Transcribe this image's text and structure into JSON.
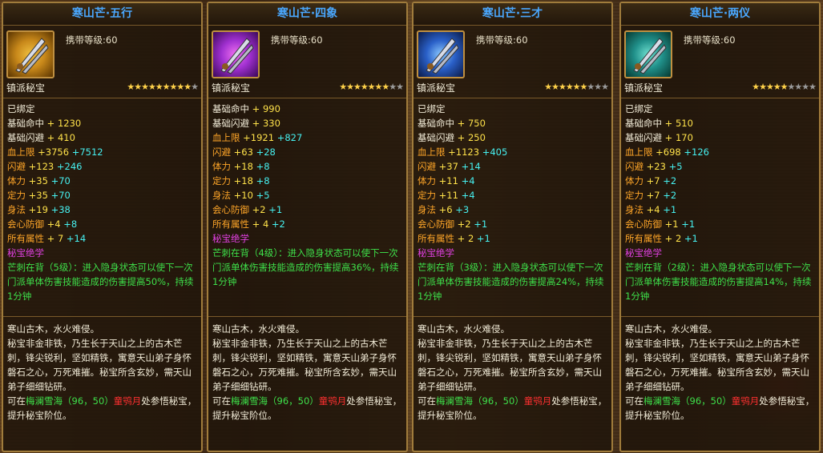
{
  "cards": [
    {
      "title": "寒山芒·五行",
      "level": "携带等级:60",
      "sect": "镇派秘宝",
      "stars_on": 9,
      "stars_off": 1,
      "bound": "已绑定",
      "hit": {
        "label": "基础命中",
        "value": "+ 1230"
      },
      "dodge": {
        "label": "基础闪避",
        "value": "+ 410"
      },
      "hp": {
        "label": "血上限",
        "value": "+3756",
        "bonus": "+7512"
      },
      "evade": {
        "label": "闪避",
        "value": "+123",
        "bonus": "+246"
      },
      "con": {
        "label": "体力",
        "value": "+35",
        "bonus": "+70"
      },
      "wis": {
        "label": "定力",
        "value": "+35",
        "bonus": "+70"
      },
      "agi": {
        "label": "身法",
        "value": "+19",
        "bonus": "+38"
      },
      "critdef": {
        "label": "会心防御",
        "value": "+4",
        "bonus": "+8"
      },
      "allattr": {
        "label": "所有属性",
        "value": "+ 7",
        "bonus": "+14"
      },
      "skill_title": "秘宝绝学",
      "skill_desc": "芒刺在背（5级）：进入隐身状态可以使下一次门派单体伤害技能造成的伤害提高50%，持续1分钟",
      "desc1": "寒山古木，水火难侵。",
      "desc2": "秘宝非金非铁，乃生长于天山之上的古木芒刺，锋尖锐利，坚如精铁，寓意天山弟子身怀磐石之心，万死难摧。秘宝所含玄妙，需天山弟子细细钻研。",
      "desc3a": "可在",
      "desc3b": "梅澜雪海（96，50）",
      "desc3c": "童鸮月",
      "desc3d": "处参悟秘宝，提升秘宝阶位。"
    },
    {
      "title": "寒山芒·四象",
      "level": "携带等级:60",
      "sect": "镇派秘宝",
      "stars_on": 7,
      "stars_off": 2,
      "bound": "",
      "hit": {
        "label": "基础命中",
        "value": "+ 990"
      },
      "dodge": {
        "label": "基础闪避",
        "value": "+ 330"
      },
      "hp": {
        "label": "血上限",
        "value": "+1921",
        "bonus": "+827"
      },
      "evade": {
        "label": "闪避",
        "value": "+63",
        "bonus": "+28"
      },
      "con": {
        "label": "体力",
        "value": "+18",
        "bonus": "+8"
      },
      "wis": {
        "label": "定力",
        "value": "+18",
        "bonus": "+8"
      },
      "agi": {
        "label": "身法",
        "value": "+10",
        "bonus": "+5"
      },
      "critdef": {
        "label": "会心防御",
        "value": "+2",
        "bonus": "+1"
      },
      "allattr": {
        "label": "所有属性",
        "value": "+ 4",
        "bonus": "+2"
      },
      "skill_title": "秘宝绝学",
      "skill_desc": "芒刺在背（4级）：进入隐身状态可以使下一次门派单体伤害技能造成的伤害提高36%，持续1分钟",
      "desc1": "寒山古木，水火难侵。",
      "desc2": "秘宝非金非铁，乃生长于天山之上的古木芒刺，锋尖锐利，坚如精铁，寓意天山弟子身怀磐石之心，万死难摧。秘宝所含玄妙，需天山弟子细细钻研。",
      "desc3a": "可在",
      "desc3b": "梅澜雪海（96，50）",
      "desc3c": "童鸮月",
      "desc3d": "处参悟秘宝，提升秘宝阶位。"
    },
    {
      "title": "寒山芒·三才",
      "level": "携带等级:60",
      "sect": "镇派秘宝",
      "stars_on": 6,
      "stars_off": 3,
      "bound": "已绑定",
      "hit": {
        "label": "基础命中",
        "value": "+ 750"
      },
      "dodge": {
        "label": "基础闪避",
        "value": "+ 250"
      },
      "hp": {
        "label": "血上限",
        "value": "+1123",
        "bonus": "+405"
      },
      "evade": {
        "label": "闪避",
        "value": "+37",
        "bonus": "+14"
      },
      "con": {
        "label": "体力",
        "value": "+11",
        "bonus": "+4"
      },
      "wis": {
        "label": "定力",
        "value": "+11",
        "bonus": "+4"
      },
      "agi": {
        "label": "身法",
        "value": "+6",
        "bonus": "+3"
      },
      "critdef": {
        "label": "会心防御",
        "value": "+2",
        "bonus": "+1"
      },
      "allattr": {
        "label": "所有属性",
        "value": "+ 2",
        "bonus": "+1"
      },
      "skill_title": "秘宝绝学",
      "skill_desc": "芒刺在背（3级）：进入隐身状态可以使下一次门派单体伤害技能造成的伤害提高24%，持续1分钟",
      "desc1": "寒山古木，水火难侵。",
      "desc2": "秘宝非金非铁，乃生长于天山之上的古木芒刺，锋尖锐利，坚如精铁，寓意天山弟子身怀磐石之心，万死难摧。秘宝所含玄妙，需天山弟子细细钻研。",
      "desc3a": "可在",
      "desc3b": "梅澜雪海（96，50）",
      "desc3c": "童鸮月",
      "desc3d": "处参悟秘宝，提升秘宝阶位。"
    },
    {
      "title": "寒山芒·两仪",
      "level": "携带等级:60",
      "sect": "镇派秘宝",
      "stars_on": 5,
      "stars_off": 4,
      "bound": "已绑定",
      "hit": {
        "label": "基础命中",
        "value": "+ 510"
      },
      "dodge": {
        "label": "基础闪避",
        "value": "+ 170"
      },
      "hp": {
        "label": "血上限",
        "value": "+698",
        "bonus": "+126"
      },
      "evade": {
        "label": "闪避",
        "value": "+23",
        "bonus": "+5"
      },
      "con": {
        "label": "体力",
        "value": "+7",
        "bonus": "+2"
      },
      "wis": {
        "label": "定力",
        "value": "+7",
        "bonus": "+2"
      },
      "agi": {
        "label": "身法",
        "value": "+4",
        "bonus": "+1"
      },
      "critdef": {
        "label": "会心防御",
        "value": "+1",
        "bonus": "+1"
      },
      "allattr": {
        "label": "所有属性",
        "value": "+ 2",
        "bonus": "+1"
      },
      "skill_title": "秘宝绝学",
      "skill_desc": "芒刺在背（2级）：进入隐身状态可以使下一次门派单体伤害技能造成的伤害提高14%，持续1分钟",
      "desc1": "寒山古木，水火难侵。",
      "desc2": "秘宝非金非铁，乃生长于天山之上的古木芒刺，锋尖锐利，坚如精铁，寓意天山弟子身怀磐石之心，万死难摧。秘宝所含玄妙，需天山弟子细细钻研。",
      "desc3a": "可在",
      "desc3b": "梅澜雪海（96，50）",
      "desc3c": "童鸮月",
      "desc3d": "处参悟秘宝，提升秘宝阶位。"
    }
  ],
  "icon_colors": [
    "#c8881a",
    "#a030d0",
    "#2a60c8",
    "#20908a"
  ],
  "icon": "twin-blade-icon"
}
